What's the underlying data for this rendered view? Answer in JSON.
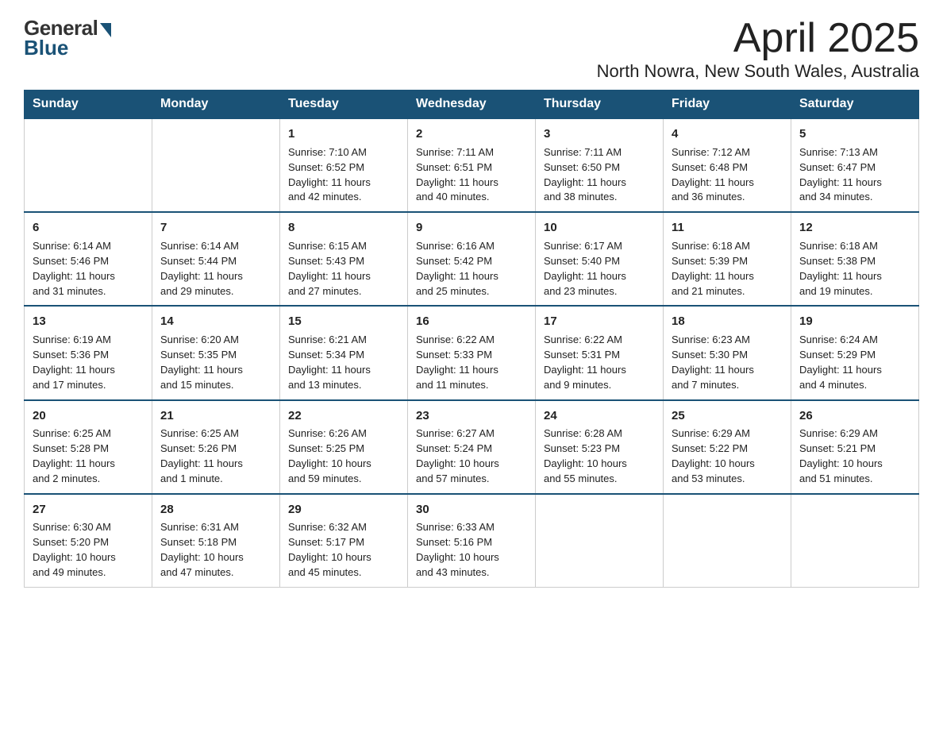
{
  "logo": {
    "general": "General",
    "blue": "Blue"
  },
  "title": {
    "month": "April 2025",
    "location": "North Nowra, New South Wales, Australia"
  },
  "weekdays": [
    "Sunday",
    "Monday",
    "Tuesday",
    "Wednesday",
    "Thursday",
    "Friday",
    "Saturday"
  ],
  "weeks": [
    [
      {
        "day": "",
        "info": ""
      },
      {
        "day": "",
        "info": ""
      },
      {
        "day": "1",
        "info": "Sunrise: 7:10 AM\nSunset: 6:52 PM\nDaylight: 11 hours\nand 42 minutes."
      },
      {
        "day": "2",
        "info": "Sunrise: 7:11 AM\nSunset: 6:51 PM\nDaylight: 11 hours\nand 40 minutes."
      },
      {
        "day": "3",
        "info": "Sunrise: 7:11 AM\nSunset: 6:50 PM\nDaylight: 11 hours\nand 38 minutes."
      },
      {
        "day": "4",
        "info": "Sunrise: 7:12 AM\nSunset: 6:48 PM\nDaylight: 11 hours\nand 36 minutes."
      },
      {
        "day": "5",
        "info": "Sunrise: 7:13 AM\nSunset: 6:47 PM\nDaylight: 11 hours\nand 34 minutes."
      }
    ],
    [
      {
        "day": "6",
        "info": "Sunrise: 6:14 AM\nSunset: 5:46 PM\nDaylight: 11 hours\nand 31 minutes."
      },
      {
        "day": "7",
        "info": "Sunrise: 6:14 AM\nSunset: 5:44 PM\nDaylight: 11 hours\nand 29 minutes."
      },
      {
        "day": "8",
        "info": "Sunrise: 6:15 AM\nSunset: 5:43 PM\nDaylight: 11 hours\nand 27 minutes."
      },
      {
        "day": "9",
        "info": "Sunrise: 6:16 AM\nSunset: 5:42 PM\nDaylight: 11 hours\nand 25 minutes."
      },
      {
        "day": "10",
        "info": "Sunrise: 6:17 AM\nSunset: 5:40 PM\nDaylight: 11 hours\nand 23 minutes."
      },
      {
        "day": "11",
        "info": "Sunrise: 6:18 AM\nSunset: 5:39 PM\nDaylight: 11 hours\nand 21 minutes."
      },
      {
        "day": "12",
        "info": "Sunrise: 6:18 AM\nSunset: 5:38 PM\nDaylight: 11 hours\nand 19 minutes."
      }
    ],
    [
      {
        "day": "13",
        "info": "Sunrise: 6:19 AM\nSunset: 5:36 PM\nDaylight: 11 hours\nand 17 minutes."
      },
      {
        "day": "14",
        "info": "Sunrise: 6:20 AM\nSunset: 5:35 PM\nDaylight: 11 hours\nand 15 minutes."
      },
      {
        "day": "15",
        "info": "Sunrise: 6:21 AM\nSunset: 5:34 PM\nDaylight: 11 hours\nand 13 minutes."
      },
      {
        "day": "16",
        "info": "Sunrise: 6:22 AM\nSunset: 5:33 PM\nDaylight: 11 hours\nand 11 minutes."
      },
      {
        "day": "17",
        "info": "Sunrise: 6:22 AM\nSunset: 5:31 PM\nDaylight: 11 hours\nand 9 minutes."
      },
      {
        "day": "18",
        "info": "Sunrise: 6:23 AM\nSunset: 5:30 PM\nDaylight: 11 hours\nand 7 minutes."
      },
      {
        "day": "19",
        "info": "Sunrise: 6:24 AM\nSunset: 5:29 PM\nDaylight: 11 hours\nand 4 minutes."
      }
    ],
    [
      {
        "day": "20",
        "info": "Sunrise: 6:25 AM\nSunset: 5:28 PM\nDaylight: 11 hours\nand 2 minutes."
      },
      {
        "day": "21",
        "info": "Sunrise: 6:25 AM\nSunset: 5:26 PM\nDaylight: 11 hours\nand 1 minute."
      },
      {
        "day": "22",
        "info": "Sunrise: 6:26 AM\nSunset: 5:25 PM\nDaylight: 10 hours\nand 59 minutes."
      },
      {
        "day": "23",
        "info": "Sunrise: 6:27 AM\nSunset: 5:24 PM\nDaylight: 10 hours\nand 57 minutes."
      },
      {
        "day": "24",
        "info": "Sunrise: 6:28 AM\nSunset: 5:23 PM\nDaylight: 10 hours\nand 55 minutes."
      },
      {
        "day": "25",
        "info": "Sunrise: 6:29 AM\nSunset: 5:22 PM\nDaylight: 10 hours\nand 53 minutes."
      },
      {
        "day": "26",
        "info": "Sunrise: 6:29 AM\nSunset: 5:21 PM\nDaylight: 10 hours\nand 51 minutes."
      }
    ],
    [
      {
        "day": "27",
        "info": "Sunrise: 6:30 AM\nSunset: 5:20 PM\nDaylight: 10 hours\nand 49 minutes."
      },
      {
        "day": "28",
        "info": "Sunrise: 6:31 AM\nSunset: 5:18 PM\nDaylight: 10 hours\nand 47 minutes."
      },
      {
        "day": "29",
        "info": "Sunrise: 6:32 AM\nSunset: 5:17 PM\nDaylight: 10 hours\nand 45 minutes."
      },
      {
        "day": "30",
        "info": "Sunrise: 6:33 AM\nSunset: 5:16 PM\nDaylight: 10 hours\nand 43 minutes."
      },
      {
        "day": "",
        "info": ""
      },
      {
        "day": "",
        "info": ""
      },
      {
        "day": "",
        "info": ""
      }
    ]
  ]
}
